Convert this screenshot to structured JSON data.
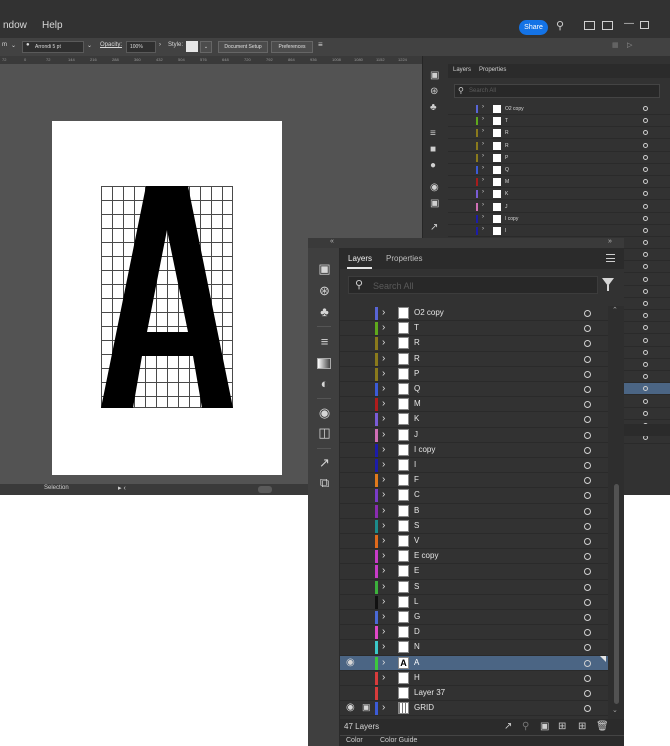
{
  "menubar": {
    "window": "ndow",
    "help": "Help",
    "share": "Share"
  },
  "control_bar": {
    "unit": "m",
    "brush": "Arrondi 5 pt",
    "opacity_label": "Opacity:",
    "opacity_value": "100%",
    "style_label": "Style:",
    "document_setup": "Document Setup",
    "preferences": "Preferences"
  },
  "ruler": [
    "72",
    "0",
    "72",
    "144",
    "216",
    "288",
    "360",
    "432",
    "504",
    "576",
    "648",
    "720",
    "792",
    "864",
    "936",
    "1008",
    "1080",
    "1152",
    "1224"
  ],
  "status": {
    "tool": "Selection"
  },
  "artwork": {
    "letter": "A"
  },
  "bg_panel": {
    "tabs": [
      "Layers",
      "Properties"
    ],
    "search_placeholder": "Search All",
    "layers": [
      {
        "name": "O2 copy",
        "color": "#5865d6"
      },
      {
        "name": "T",
        "color": "#5fa81c"
      },
      {
        "name": "R",
        "color": "#8a7a1c"
      },
      {
        "name": "R",
        "color": "#8a7a1c"
      },
      {
        "name": "P",
        "color": "#8a7a1c"
      },
      {
        "name": "Q",
        "color": "#3c5bd6"
      },
      {
        "name": "M",
        "color": "#a81c1c"
      },
      {
        "name": "K",
        "color": "#7a5cd6"
      },
      {
        "name": "J",
        "color": "#d06fb5"
      },
      {
        "name": "I copy",
        "color": "#1c1ca8"
      },
      {
        "name": "I",
        "color": "#1c1ca8"
      }
    ]
  },
  "panel": {
    "tabs": {
      "layers": "Layers",
      "properties": "Properties"
    },
    "search_placeholder": "Search All",
    "layers": [
      {
        "name": "O2 copy",
        "color": "#5865d6",
        "thumb": ""
      },
      {
        "name": "T",
        "color": "#5fa81c",
        "thumb": ""
      },
      {
        "name": "R",
        "color": "#8a7a1c",
        "thumb": ""
      },
      {
        "name": "R",
        "color": "#8a7a1c",
        "thumb": ""
      },
      {
        "name": "P",
        "color": "#8a7a1c",
        "thumb": ""
      },
      {
        "name": "Q",
        "color": "#3c5bd6",
        "thumb": ""
      },
      {
        "name": "M",
        "color": "#b01c1c",
        "thumb": ""
      },
      {
        "name": "K",
        "color": "#7a5cd6",
        "thumb": ""
      },
      {
        "name": "J",
        "color": "#d06fb5",
        "thumb": ""
      },
      {
        "name": "I copy",
        "color": "#1c1ca8",
        "thumb": ""
      },
      {
        "name": "I",
        "color": "#1c1ca8",
        "thumb": ""
      },
      {
        "name": "F",
        "color": "#e07a1c",
        "thumb": ""
      },
      {
        "name": "C",
        "color": "#7a3cc8",
        "thumb": ""
      },
      {
        "name": "B",
        "color": "#8a2cb0",
        "thumb": ""
      },
      {
        "name": "S",
        "color": "#1c8a8a",
        "thumb": ""
      },
      {
        "name": "V",
        "color": "#e06a1c",
        "thumb": ""
      },
      {
        "name": "E copy",
        "color": "#c83cc8",
        "thumb": ""
      },
      {
        "name": "E",
        "color": "#c83cc8",
        "thumb": ""
      },
      {
        "name": "S",
        "color": "#3cb03c",
        "thumb": ""
      },
      {
        "name": "L",
        "color": "#111111",
        "thumb": ""
      },
      {
        "name": "G",
        "color": "#4a6ad6",
        "thumb": ""
      },
      {
        "name": "D",
        "color": "#e048c8",
        "thumb": ""
      },
      {
        "name": "N",
        "color": "#3cc8c8",
        "thumb": ""
      },
      {
        "name": "A",
        "color": "#3cc83c",
        "thumb": "A",
        "selected": true,
        "visible": true
      },
      {
        "name": "H",
        "color": "#d83c3c",
        "thumb": ""
      },
      {
        "name": "Layer 37",
        "color": "#d83c3c",
        "thumb": "",
        "no_chevron": true
      },
      {
        "name": "GRID",
        "color": "#3c5bd6",
        "thumb": "",
        "visible": true,
        "locked": true,
        "grid": true
      }
    ],
    "layer_count": "47 Layers",
    "bottom_tabs": {
      "color": "Color",
      "color_guide": "Color Guide"
    }
  }
}
